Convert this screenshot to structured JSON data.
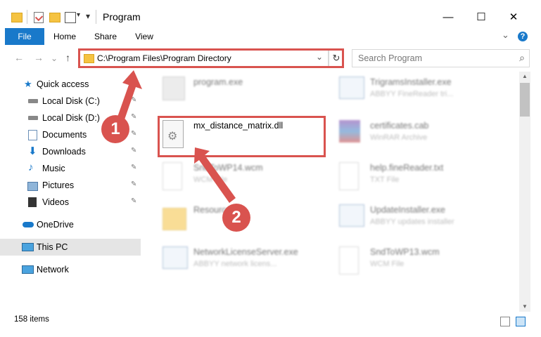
{
  "window": {
    "title": "Program",
    "minimize": "—",
    "maximize": "☐",
    "close": "✕"
  },
  "ribbon": {
    "tabs": [
      "File",
      "Home",
      "Share",
      "View"
    ],
    "chevron": "⌄",
    "help": "?"
  },
  "nav": {
    "back": "←",
    "forward": "→",
    "recent": "⌄",
    "up": "↑",
    "address": "C:\\Program Files\\Program Directory",
    "address_dropdown": "⌄",
    "refresh": "↻",
    "search_placeholder": "Search Program",
    "search_icon": "⌕"
  },
  "sidebar": {
    "items": [
      {
        "label": "Quick access",
        "icon": "star-icon",
        "pinned": false
      },
      {
        "label": "Local Disk (C:)",
        "icon": "drive-icon",
        "pinned": true
      },
      {
        "label": "Local Disk (D:)",
        "icon": "drive-icon",
        "pinned": true
      },
      {
        "label": "Documents",
        "icon": "documents-icon",
        "pinned": true
      },
      {
        "label": "Downloads",
        "icon": "downloads-icon",
        "pinned": true
      },
      {
        "label": "Music",
        "icon": "music-icon",
        "pinned": true
      },
      {
        "label": "Pictures",
        "icon": "pictures-icon",
        "pinned": true
      },
      {
        "label": "Videos",
        "icon": "videos-icon",
        "pinned": true
      },
      {
        "label": "OneDrive",
        "icon": "cloud-icon",
        "pinned": false
      },
      {
        "label": "This PC",
        "icon": "computer-icon",
        "pinned": false,
        "selected": true
      },
      {
        "label": "Network",
        "icon": "network-icon",
        "pinned": false
      }
    ],
    "pin_glyph": "📌"
  },
  "files": [
    {
      "name": "program.exe",
      "type": "",
      "icon": "exe-icon"
    },
    {
      "name": "TrigramsInstaller.exe",
      "type": "ABBYY FineReader tri...",
      "icon": "installer-icon"
    },
    {
      "name": "mx_distance_matrix.dll",
      "type": "",
      "icon": "dll-gear-icon"
    },
    {
      "name": "certificates.cab",
      "type": "WinRAR Archive",
      "icon": "archive-icon"
    },
    {
      "name": "SndToWP14.wcm",
      "type": "WCM File",
      "icon": "blank-file-icon"
    },
    {
      "name": "help.fineReader.txt",
      "type": "TXT File",
      "icon": "blank-file-icon"
    },
    {
      "name": "Resources",
      "type": "",
      "icon": "folder-icon"
    },
    {
      "name": "UpdateInstaller.exe",
      "type": "ABBYY updates installer",
      "icon": "installer-icon"
    },
    {
      "name": "NetworkLicenseServer.exe",
      "type": "ABBYY network licens...",
      "icon": "installer-icon"
    },
    {
      "name": "SndToWP13.wcm",
      "type": "WCM File",
      "icon": "blank-file-icon"
    }
  ],
  "status": {
    "count": "158 items"
  },
  "annotations": {
    "step1": "1",
    "step2": "2",
    "accent": "#d9534f"
  },
  "colors": {
    "file_tab": "#1979ca",
    "selected_row": "#e5e5e5"
  }
}
